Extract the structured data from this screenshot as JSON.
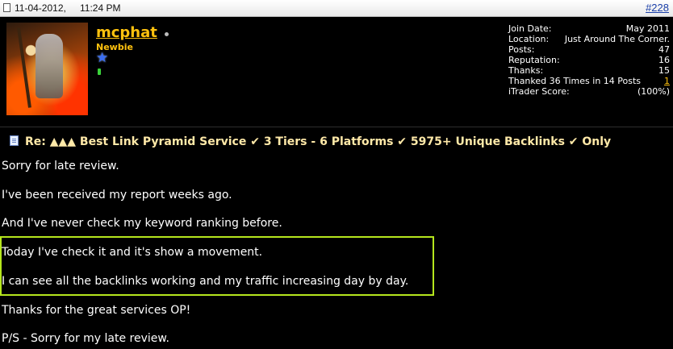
{
  "post": {
    "date": "11-04-2012,",
    "time": "11:24 PM",
    "number": "#228"
  },
  "user": {
    "name": "mcphat",
    "title": "Newbie",
    "stats": [
      {
        "label": "Join Date:",
        "value": "May 2011"
      },
      {
        "label": "Location:",
        "value": "Just Around The Corner."
      },
      {
        "label": "Posts:",
        "value": "47"
      },
      {
        "label": "Reputation:",
        "value": "16"
      },
      {
        "label": "Thanks:",
        "value": "15"
      },
      {
        "label": "Thanked 36 Times in 14 Posts",
        "value": "1"
      },
      {
        "label": "iTrader Score:",
        "value": "(100%)"
      }
    ]
  },
  "content": {
    "title": "Re: ▲▲▲ Best Link Pyramid Service ✔ 3 Tiers - 6 Platforms ✔ 5975+ Unique Backlinks ✔ Only",
    "lines": [
      "Sorry for late review.",
      "I've been received my report weeks ago.",
      "And I've never check my keyword ranking before.",
      "Today I've check it and it's show a movement.",
      "I can see all the backlinks working and my traffic increasing day by day.",
      "Thanks for the great services OP!",
      "P/S - Sorry for my late review."
    ]
  },
  "icons": {
    "post_icon": "post-page-icon",
    "status": "offline-status-dot",
    "rank": "rank-star-icon",
    "title_icon": "post-title-page-icon"
  },
  "colors": {
    "username": "#ffc20e",
    "highlight_border": "#b5e61d",
    "background": "#000000",
    "title_text": "#ffe9a8"
  }
}
